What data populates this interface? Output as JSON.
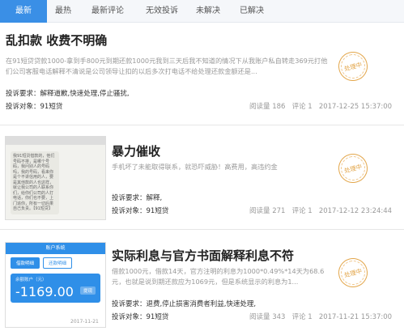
{
  "tabs": [
    "最新",
    "最热",
    "最新评论",
    "无效投诉",
    "未解决",
    "已解决"
  ],
  "active_tab": 0,
  "colors": {
    "tab_active": "#3a8fe6",
    "stamp": "#e3a64a"
  },
  "labels": {
    "demand": "投诉要求：",
    "target": "投诉对象：",
    "reads": "阅读量",
    "comments": "评论"
  },
  "posts": [
    {
      "title": "乱扣款 收费不明确",
      "desc": "在91短贷贷款1000-拿到手800元到期还款1000元我到三天后我不知道的情况下从我账户私自转走369元打他们公司客服电话解释不清说是公司领导让扣的以后多次打电话不给处理还款金额还是...",
      "demand": "解释道歉,快速处理,停止骚扰,",
      "target": "91短贷",
      "reads": "186",
      "comments": "1",
      "time": "2017-12-25 15:37:00",
      "stamp": "处理中"
    },
    {
      "title": "暴力催收",
      "desc": "手机坏了未能取得联系，就恐吓威胁！高费用，高违约金",
      "demand": "解释,",
      "target": "91短贷",
      "reads": "271",
      "comments": "1",
      "time": "2017-12-12 23:24:44",
      "stamp": "处理中",
      "thumb_text": "我91短贷借款的，他们号码不排，是哪个号码，我问别人的号码吗，我的号码，看来你是个不讲信用的人，要是其他款的人也这样，就让我公司的人联系你们，给你们公司的人打电话，你们也不要，上门追你，所有一切后果自己负责。【91短贷】"
    },
    {
      "title": "实际利息与官方书面解释利息不符",
      "desc": "借款1000元，借款14天，官方注明的利息为1000*0.49%*14天为68.6元，也就是说到期还款应为1069元，但是系统显示的利息为1...",
      "demand": "退费,停止损害消费者利益,快速处理,",
      "target": "91短贷",
      "reads": "343",
      "comments": "1",
      "time": "2017-11-21 15:37:00",
      "stamp": "处理中",
      "app": {
        "header": "账户系统",
        "tab1": "借款明细",
        "tab2": "还款明细",
        "balance_label": "余额账户（元）",
        "balance": "-1169.00",
        "balance_btn": "提现",
        "date": "2017-11-21"
      }
    }
  ]
}
